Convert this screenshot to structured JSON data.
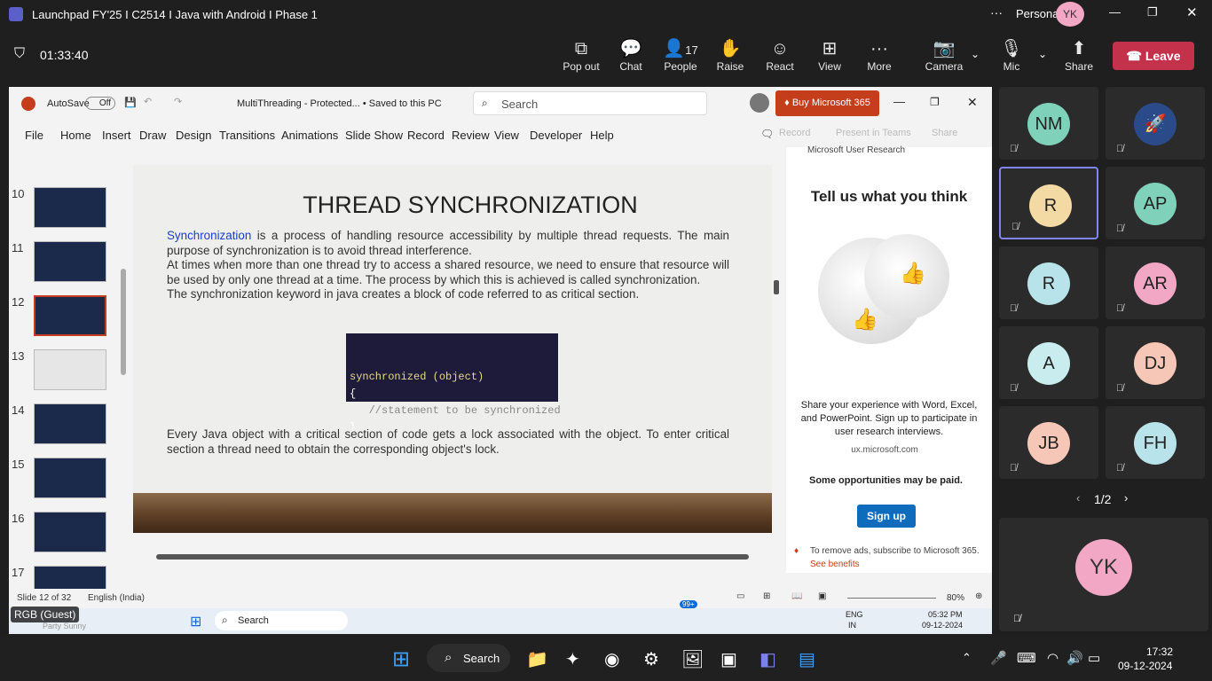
{
  "teams": {
    "title": "Launchpad FY'25 I C2514 I Java with Android I Phase 1",
    "account": "Personal",
    "avatar": "YK",
    "timer": "01:33:40",
    "buttons": [
      {
        "icon": "popout-icon",
        "label": "Pop out"
      },
      {
        "icon": "chat-icon",
        "label": "Chat"
      },
      {
        "icon": "people-icon",
        "label": "People",
        "count": "17"
      },
      {
        "icon": "raise-hand-icon",
        "label": "Raise"
      },
      {
        "icon": "react-icon",
        "label": "React"
      },
      {
        "icon": "view-icon",
        "label": "View"
      },
      {
        "icon": "more-icon",
        "label": "More"
      },
      {
        "icon": "camera-off-icon",
        "label": "Camera"
      },
      {
        "icon": "mic-off-icon",
        "label": "Mic"
      },
      {
        "icon": "share-icon",
        "label": "Share"
      }
    ],
    "leave": "Leave"
  },
  "ppt": {
    "autosave": "AutoSave",
    "toggle": "Off",
    "filename": "MultiThreading  -  Protected...  •  Saved to this PC",
    "search": "Search",
    "buy": "Buy Microsoft 365",
    "tabs": [
      "File",
      "Home",
      "Insert",
      "Draw",
      "Design",
      "Transitions",
      "Animations",
      "Slide Show",
      "Record",
      "Review",
      "View",
      "Developer",
      "Help"
    ],
    "record": "Record",
    "present": "Present in Teams",
    "share": "Share",
    "thumbs": [
      "10",
      "11",
      "12",
      "13",
      "14",
      "15",
      "16",
      "17"
    ],
    "status": {
      "slide": "Slide 12 of 32",
      "lang": "English (India)",
      "zoom": "80%"
    }
  },
  "slide": {
    "title": "THREAD SYNCHRONIZATION",
    "keyword": "Synchronization",
    "p1": " is a process of handling resource accessibility by multiple thread requests. The main purpose of synchronization is to avoid thread interference.",
    "p2": "At times when more than one thread try to access a shared resource, we need to ensure that resource will be used by only one thread at a time. The process by which this is achieved is called synchronization.",
    "p3": "The synchronization keyword in java creates a block of code referred to as critical section.",
    "code": [
      "synchronized (object)",
      "{",
      "   //statement to be synchronized",
      "}"
    ],
    "p4": "Every Java object with a critical section of code gets a lock associated with the object. To enter critical section a thread need to obtain the corresponding object's lock."
  },
  "ad": {
    "source": "Microsoft User Research",
    "title": "Tell us what you think",
    "body": "Share your experience with Word, Excel, and PowerPoint. Sign up to participate in user research interviews.",
    "url": "ux.microsoft.com",
    "paid": "Some opportunities may be paid.",
    "signup": "Sign up",
    "remove": "To remove ads, subscribe to Microsoft 365.",
    "benefits": "See benefits"
  },
  "inner_taskbar": {
    "search": "Search",
    "lang1": "ENG",
    "lang2": "IN",
    "time": "05:32 PM",
    "date": "09-12-2024",
    "badge": "99+"
  },
  "presenter": "RGB (Guest)",
  "presenter_sub": "Party Sunny",
  "participants": [
    {
      "i": "NM",
      "c": "#7fd1b9"
    },
    {
      "i": "",
      "c": "#2a4a8a"
    },
    {
      "i": "R",
      "c": "#f3d9a4"
    },
    {
      "i": "AP",
      "c": "#7fd1b9"
    },
    {
      "i": "R",
      "c": "#b9e3ea"
    },
    {
      "i": "AR",
      "c": "#f2a7c4"
    },
    {
      "i": "A",
      "c": "#c9ecee"
    },
    {
      "i": "DJ",
      "c": "#f6c7b6"
    },
    {
      "i": "JB",
      "c": "#f6c7b6"
    },
    {
      "i": "FH",
      "c": "#b9e3ea"
    }
  ],
  "pager": "1/2",
  "self": "YK",
  "taskbar": {
    "search": "Search",
    "time": "17:32",
    "date": "09-12-2024"
  }
}
